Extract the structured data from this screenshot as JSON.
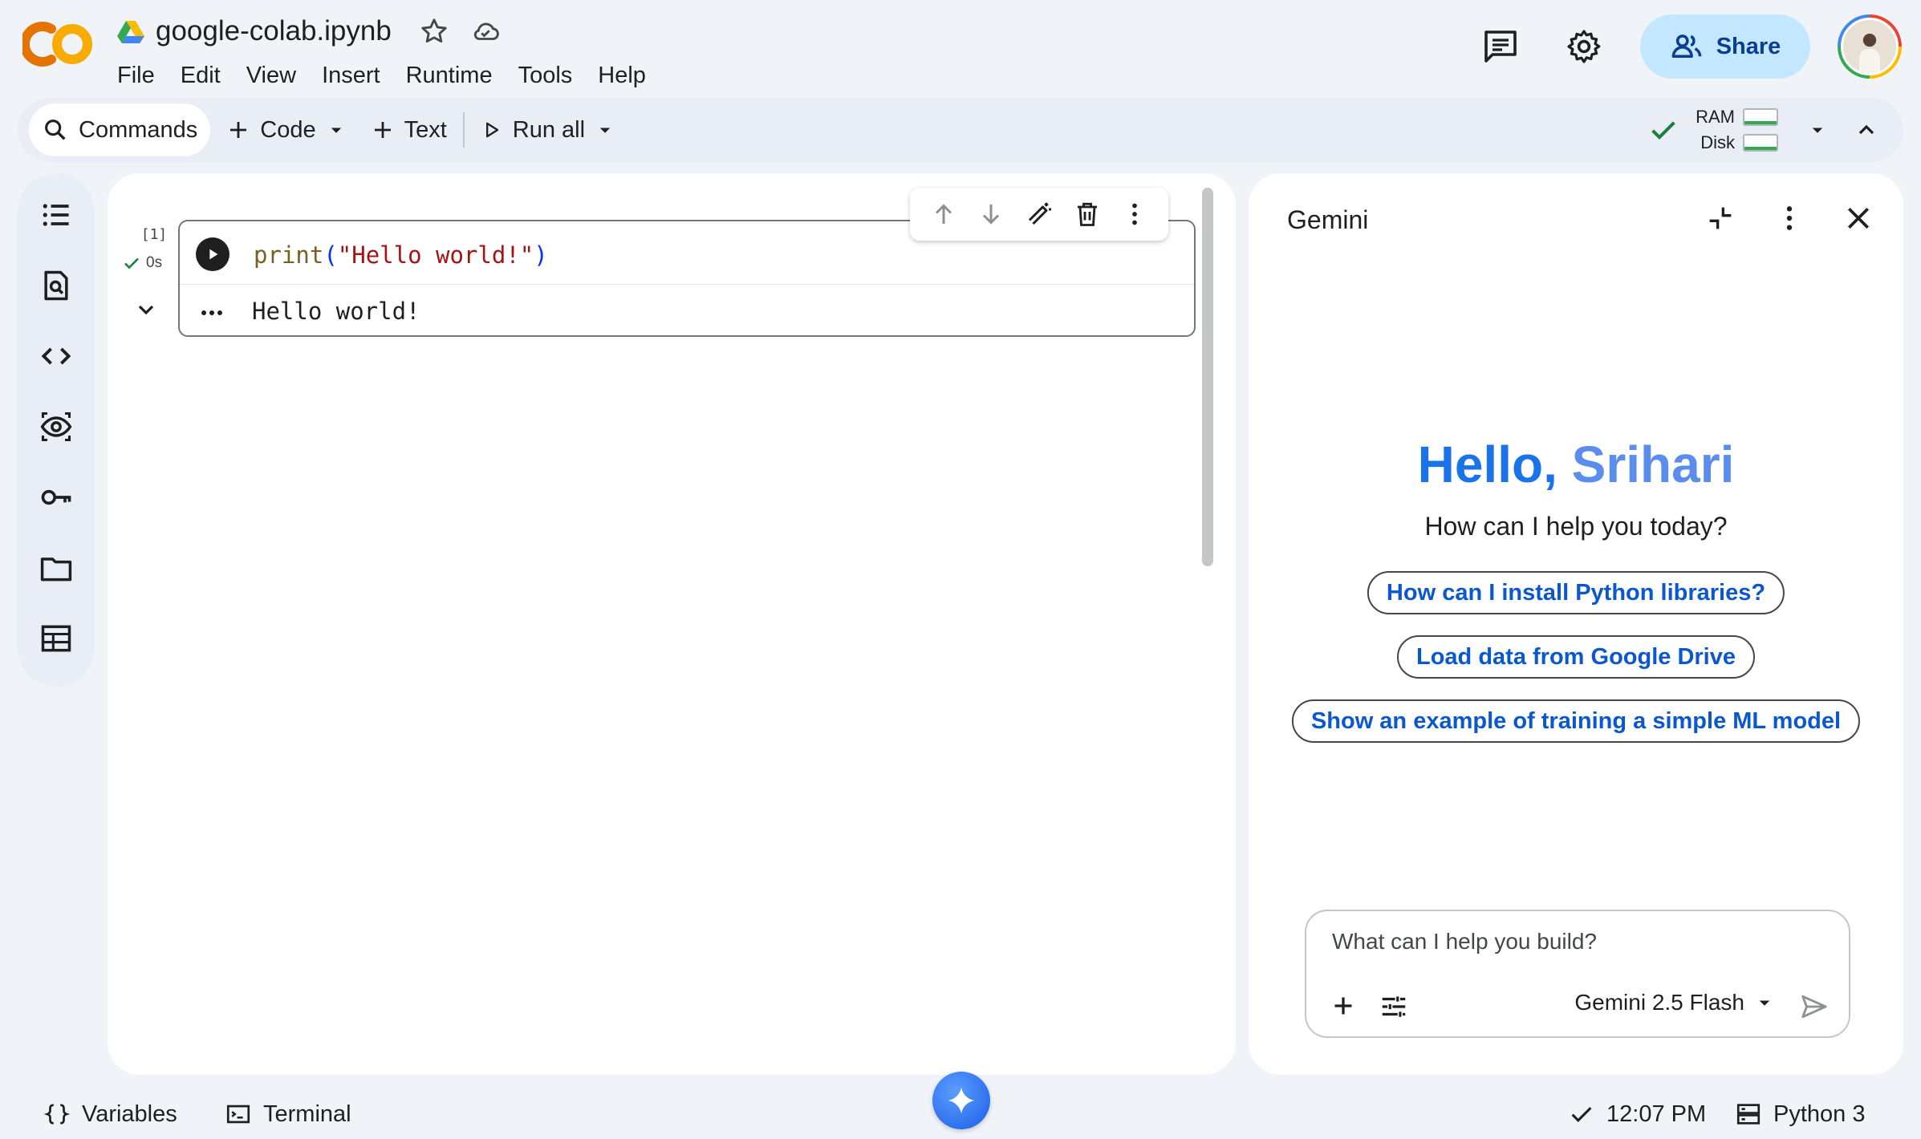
{
  "header": {
    "logo": "CO",
    "doc_title": "google-colab.ipynb",
    "menu": [
      "File",
      "Edit",
      "View",
      "Insert",
      "Runtime",
      "Tools",
      "Help"
    ],
    "share_label": "Share"
  },
  "toolbar": {
    "commands_label": "Commands",
    "code_label": "Code",
    "text_label": "Text",
    "run_all_label": "Run all",
    "ram_label": "RAM",
    "disk_label": "Disk"
  },
  "cell": {
    "exec_count": "[1]",
    "duration": "0s",
    "code": {
      "fn": "print",
      "open": "(",
      "str": "\"Hello world!\"",
      "close": ")"
    },
    "output": "Hello world!"
  },
  "gemini": {
    "title": "Gemini",
    "greeting_hello": "Hello,",
    "greeting_name": "Srihari",
    "subtitle": "How can I help you today?",
    "suggestions": [
      "How can I install Python libraries?",
      "Load data from Google Drive",
      "Show an example of training a simple ML model"
    ],
    "prompt_placeholder": "What can I help you build?",
    "model": "Gemini 2.5 Flash"
  },
  "status_bar": {
    "variables_label": "Variables",
    "terminal_label": "Terminal",
    "time": "12:07 PM",
    "runtime": "Python 3"
  },
  "colors": {
    "accent": "#0b57d0",
    "share_bg": "#c2e7ff",
    "logo_orange": "#f9ab00",
    "logo_dark_orange": "#e37400",
    "success": "#34a853"
  },
  "icons": {
    "rail": [
      "toc-icon",
      "find-icon",
      "code-snippets-icon",
      "secrets-eye-icon",
      "key-icon",
      "folder-icon",
      "table-icon"
    ]
  }
}
